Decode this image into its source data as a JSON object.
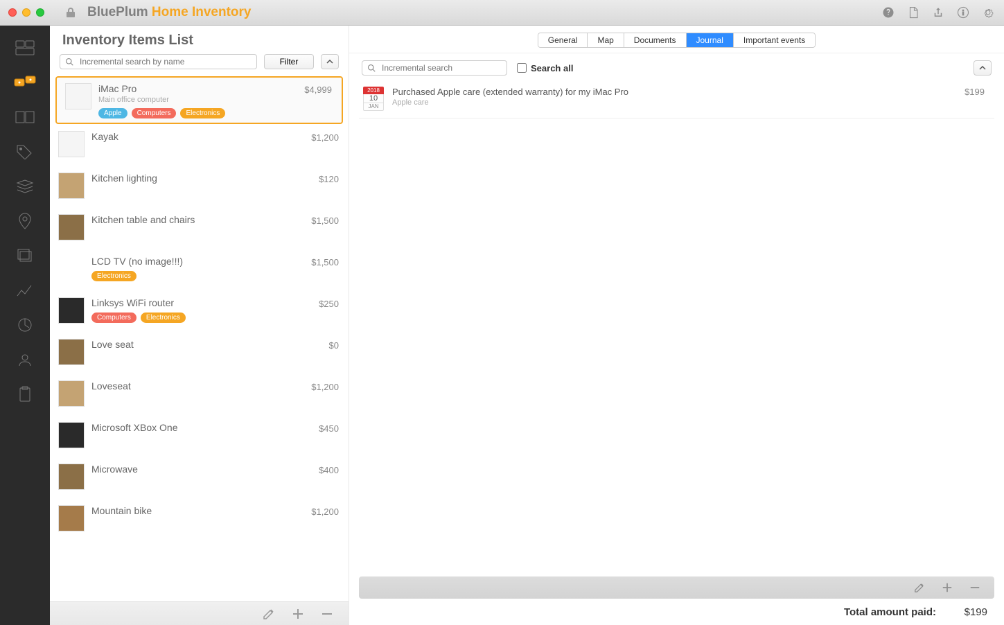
{
  "app": {
    "name_a": "BluePlum",
    "name_b": "Home Inventory"
  },
  "list": {
    "heading": "Inventory Items List",
    "search_placeholder": "Incremental search by name",
    "filter_label": "Filter",
    "items": [
      {
        "name": "iMac Pro",
        "subtitle": "Main office computer",
        "price": "$4,999",
        "tags": [
          "apple",
          "computers",
          "electronics"
        ],
        "thumb": "white",
        "selected": true
      },
      {
        "name": "Kayak",
        "price": "$1,200",
        "thumb": "white"
      },
      {
        "name": "Kitchen lighting",
        "price": "$120",
        "thumb": "tan"
      },
      {
        "name": "Kitchen table and chairs",
        "price": "$1,500",
        "thumb": "brown"
      },
      {
        "name": "LCD TV (no image!!!)",
        "price": "$1,500",
        "tags": [
          "electronics"
        ],
        "thumb": "missing"
      },
      {
        "name": "Linksys WiFi router",
        "price": "$250",
        "tags": [
          "computers",
          "electronics"
        ],
        "thumb": "dark"
      },
      {
        "name": "Love seat",
        "price": "$0",
        "thumb": "brown"
      },
      {
        "name": "Loveseat",
        "price": "$1,200",
        "thumb": "tan"
      },
      {
        "name": "Microsoft XBox One",
        "price": "$450",
        "thumb": "dark"
      },
      {
        "name": "Microwave",
        "price": "$400",
        "thumb": "brown"
      },
      {
        "name": "Mountain bike",
        "price": "$1,200",
        "thumb": "wood"
      }
    ]
  },
  "tag_labels": {
    "apple": "Apple",
    "computers": "Computers",
    "electronics": "Electronics"
  },
  "detail": {
    "tabs": [
      "General",
      "Map",
      "Documents",
      "Journal",
      "Important events"
    ],
    "active_tab": 3,
    "search_placeholder": "Incremental search",
    "search_all_label": "Search all",
    "journal": [
      {
        "year": "2018",
        "day": "10",
        "month": "JAN",
        "title": "Purchased Apple care (extended warranty) for my iMac Pro",
        "subtitle": "Apple care",
        "amount": "$199"
      }
    ],
    "total_label": "Total amount paid:",
    "total_value": "$199"
  }
}
